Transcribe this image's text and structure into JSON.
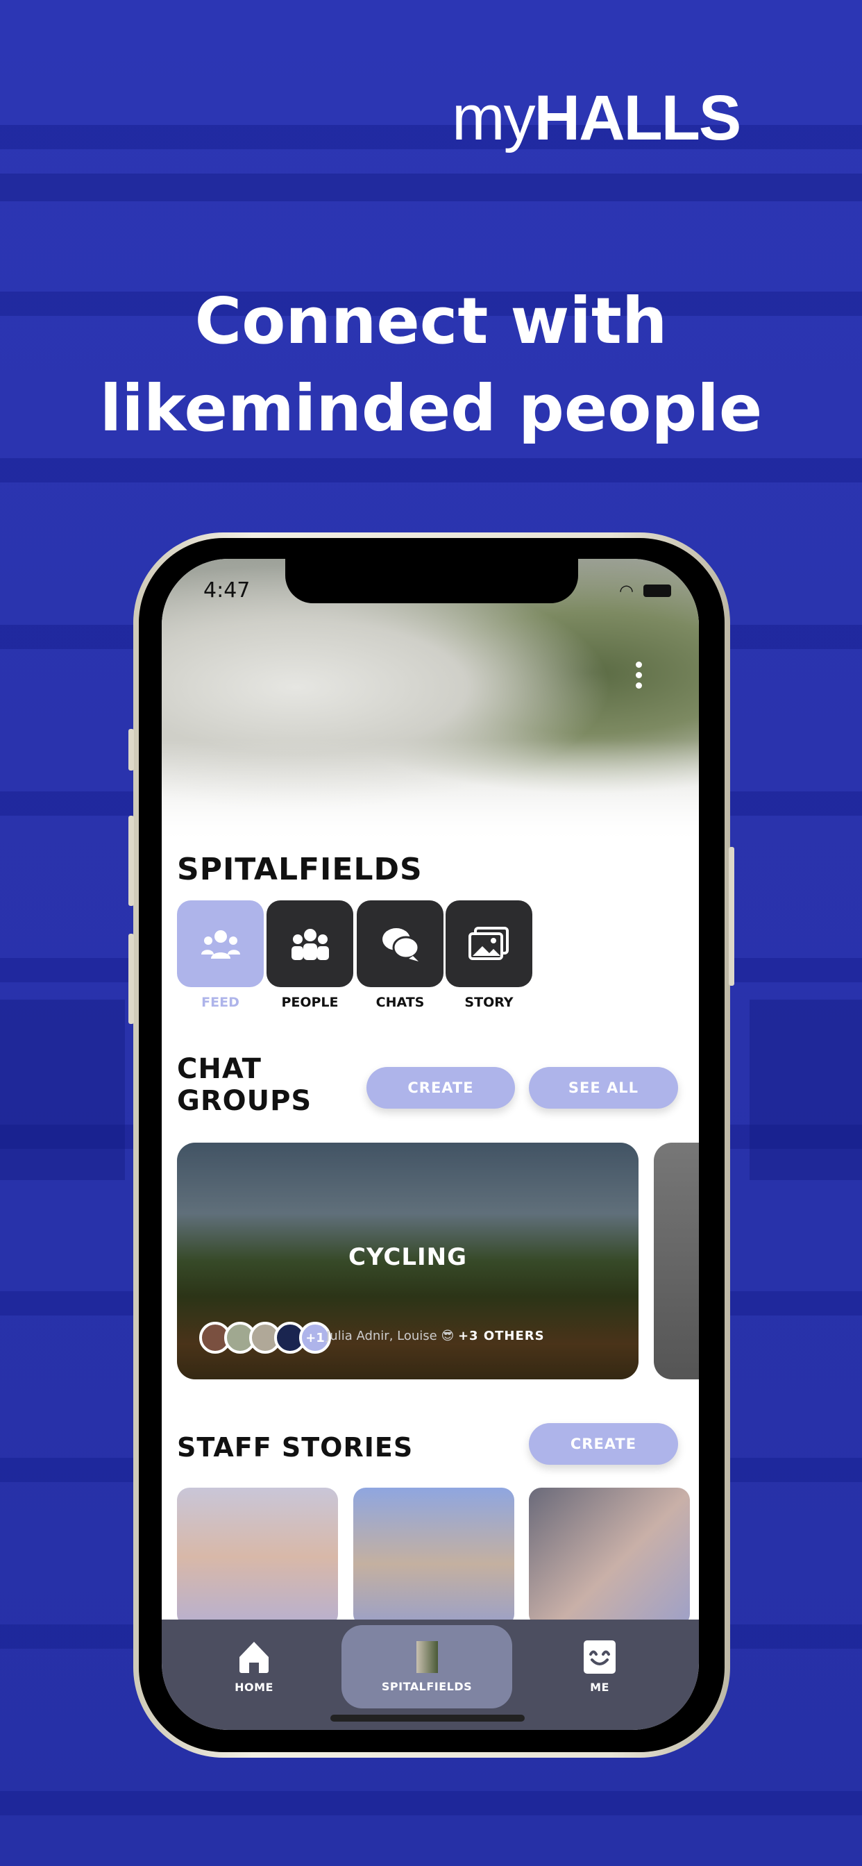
{
  "brand": {
    "logo_prefix": "my",
    "logo_main": "HALLS"
  },
  "headline": {
    "line1": "Connect with",
    "line2": "likeminded people"
  },
  "status_bar": {
    "time": "4:47"
  },
  "hall": {
    "title": "SPITALFIELDS",
    "tiles": [
      {
        "label": "FEED",
        "icon": "feed-icon",
        "active": true
      },
      {
        "label": "PEOPLE",
        "icon": "people-icon"
      },
      {
        "label": "CHATS",
        "icon": "chats-icon"
      },
      {
        "label": "STORY",
        "icon": "story-icon"
      }
    ]
  },
  "chat_groups": {
    "title_line1": "CHAT",
    "title_line2": "GROUPS",
    "create_label": "CREATE",
    "see_all_label": "SEE ALL",
    "cards": [
      {
        "title": "CYCLING",
        "extra_avatars": "+1",
        "members_text": "Julia Adnir, Louise 😎",
        "others": "+3 OTHERS"
      }
    ]
  },
  "staff_stories": {
    "title": "STAFF STORIES",
    "create_label": "CREATE"
  },
  "tab_bar": {
    "items": [
      {
        "label": "HOME",
        "icon": "home-icon"
      },
      {
        "label": "SPITALFIELDS",
        "icon": "hall-thumbnail",
        "active": true
      },
      {
        "label": "ME",
        "icon": "smiley-icon"
      }
    ]
  },
  "colors": {
    "background": "#2a33ad",
    "accent": "#aeb4ea",
    "tile_dark": "#2c2c2e",
    "tab_bar": "#4c4e60"
  }
}
